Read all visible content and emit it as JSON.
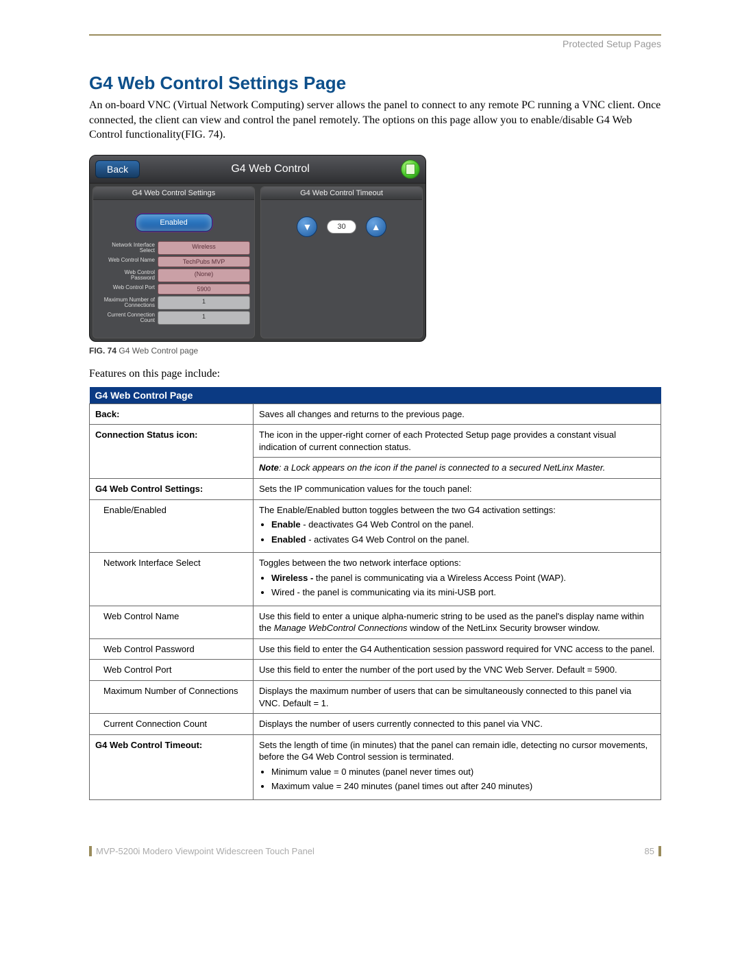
{
  "header": {
    "category": "Protected Setup Pages"
  },
  "section": {
    "title": "G4 Web Control Settings Page",
    "intro": "An on-board VNC (Virtual Network Computing) server allows the panel to connect to any remote PC running a VNC client. Once connected, the client can view and control the panel remotely. The options on this page allow you to enable/disable G4 Web Control functionality(FIG. 74).",
    "lead2": "Features on this page include:"
  },
  "panel": {
    "back": "Back",
    "title": "G4 Web Control",
    "left_head": "G4 Web Control Settings",
    "right_head": "G4 Web Control Timeout",
    "enabled_btn": "Enabled",
    "timeout_value": "30",
    "rows": [
      {
        "label": "Network Interface Select",
        "value": "Wireless",
        "plain": false
      },
      {
        "label": "Web Control Name",
        "value": "TechPubs MVP",
        "plain": false
      },
      {
        "label": "Web Control Password",
        "value": "(None)",
        "plain": false
      },
      {
        "label": "Web Control Port",
        "value": "5900",
        "plain": false
      },
      {
        "label": "Maximum Number of Connections",
        "value": "1",
        "plain": true
      },
      {
        "label": "Current Connection Count",
        "value": "1",
        "plain": true
      }
    ]
  },
  "fig": {
    "num": "FIG. 74",
    "caption": "G4 Web Control page"
  },
  "table": {
    "head": "G4 Web Control Page",
    "back_l": "Back:",
    "back_v": "Saves all changes and returns to the previous page.",
    "csi_l": "Connection Status icon:",
    "csi_v": "The icon in the upper-right corner of each Protected Setup page provides a constant visual indication of current connection status.",
    "csi_note_prefix": "Note",
    "csi_note": ": a Lock appears on the icon if the panel is connected to a secured NetLinx Master.",
    "wcs_l": "G4 Web Control Settings:",
    "wcs_v": "Sets the IP communication values for the touch panel:",
    "ee_l": "Enable/Enabled",
    "ee_v": "The Enable/Enabled button toggles between the two G4 activation settings:",
    "ee_b1a": "Enable",
    "ee_b1b": " - deactivates G4 Web Control on the panel.",
    "ee_b2a": "Enabled",
    "ee_b2b": " - activates G4 Web Control on the panel.",
    "nis_l": "Network Interface Select",
    "nis_v": "Toggles between the two network interface options:",
    "nis_b1a": "Wireless -",
    "nis_b1b": " the panel is communicating via a Wireless Access Point (WAP).",
    "nis_b2": "Wired - the panel is communicating via its mini-USB port.",
    "wcn_l": "Web Control Name",
    "wcn_v1": "Use this field to enter a unique alpha-numeric string to be used as the panel's display name within the ",
    "wcn_em": "Manage WebControl Connections",
    "wcn_v2": " window of the NetLinx Security browser window.",
    "wcp_l": "Web Control Password",
    "wcp_v": "Use this field to enter the G4 Authentication session password required for VNC access to the panel.",
    "wcport_l": "Web Control Port",
    "wcport_v": "Use this field to enter the number of the port used by the VNC Web Server. Default = 5900.",
    "max_l": "Maximum Number of Connections",
    "max_v": "Displays the maximum number of users that can be simultaneously connected to this panel via VNC. Default = 1.",
    "ccc_l": "Current Connection Count",
    "ccc_v": "Displays the number of users currently connected to this panel via VNC.",
    "to_l": "G4 Web Control Timeout:",
    "to_v": "Sets the length of time (in minutes) that the panel can remain idle, detecting no cursor movements, before the G4 Web Control session is terminated.",
    "to_b1": "Minimum value = 0 minutes (panel never times out)",
    "to_b2": "Maximum value = 240 minutes (panel times out after 240 minutes)"
  },
  "footer": {
    "product": "MVP-5200i Modero Viewpoint Widescreen Touch Panel",
    "page": "85"
  }
}
